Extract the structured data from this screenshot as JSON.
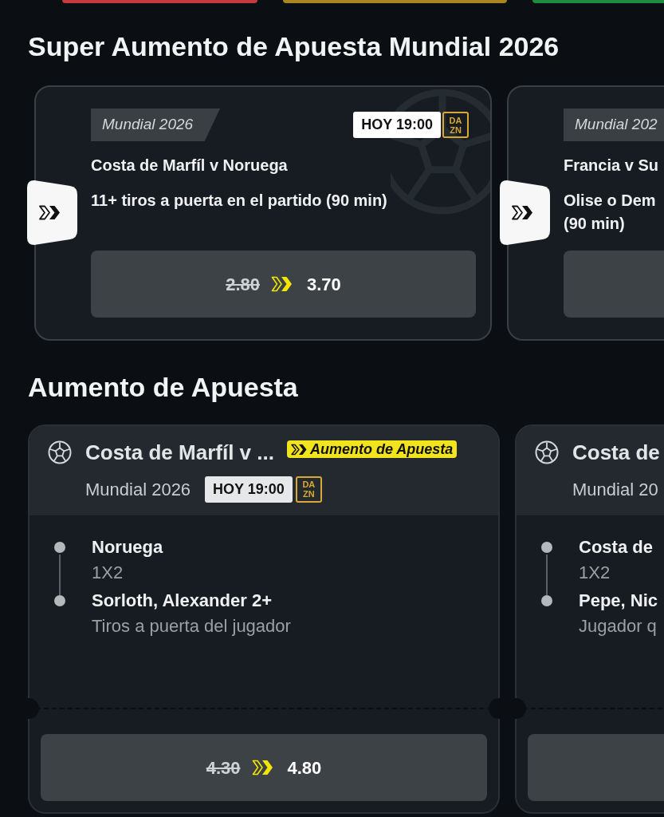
{
  "top_banners": [
    {
      "color": "#c53a3c"
    },
    {
      "color": "#a8851f"
    },
    {
      "color": "#1d8c3c"
    }
  ],
  "super_boosts": {
    "title": "Super Aumento de Apuesta Mundial 2026",
    "cards": [
      {
        "competition": "Mundial 2026",
        "time": "HOY 19:00",
        "channel_logo": "DA ZN",
        "match": "Costa de Marfíl v Noruega",
        "market_lines": [
          "11+ tiros a puerta en el partido (90 min)"
        ],
        "odds": {
          "old": "2.80",
          "new": "3.70"
        }
      },
      {
        "competition": "Mundial 202",
        "match": "Francia v Su",
        "market_lines": [
          "Olise o Dem",
          "(90 min)"
        ]
      }
    ]
  },
  "boosts": {
    "title": "Aumento de Apuesta",
    "cards": [
      {
        "match": "Costa de Marfíl v ...",
        "badge": "Aumento de Apuesta",
        "competition": "Mundial 2026",
        "time": "HOY 19:00",
        "channel_logo": "DA ZN",
        "legs": [
          {
            "selection": "Noruega",
            "market": "1X2"
          },
          {
            "selection": "Sorloth, Alexander 2+",
            "market": "Tiros a puerta del jugador"
          }
        ],
        "odds": {
          "old": "4.30",
          "new": "4.80"
        }
      },
      {
        "match": "Costa de",
        "competition": "Mundial 20",
        "legs": [
          {
            "selection": "Costa de",
            "market": "1X2"
          },
          {
            "selection": "Pepe, Nic",
            "market": "Jugador q"
          }
        ]
      }
    ]
  }
}
